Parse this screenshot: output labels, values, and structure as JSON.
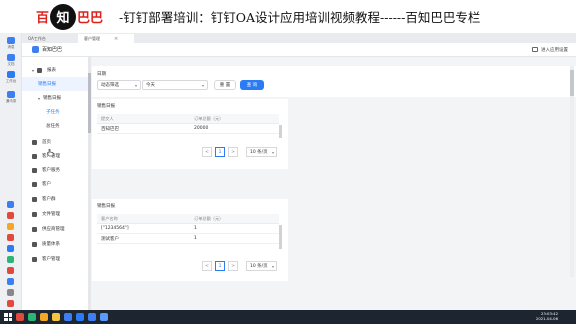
{
  "banner": {
    "brand_part1": "百",
    "brand_circle": "知",
    "brand_part2": "巴巴",
    "title": "-钉钉部署培训：钉钉OA设计应用培训视频教程------百知巴巴专栏"
  },
  "dock": [
    {
      "icon": "message-icon",
      "label": "消息",
      "color": "#3d7ef0"
    },
    {
      "icon": "document-icon",
      "label": "文档",
      "color": "#3d7ef0"
    },
    {
      "icon": "workbench-icon",
      "label": "工作台",
      "color": "#2a7bf4"
    },
    {
      "icon": "contacts-icon",
      "label": "通讯录",
      "color": "#3d7ef0"
    }
  ],
  "dock_bottom_colors": [
    "#3d7ef0",
    "#e0493b",
    "#f5a623",
    "#e0493b",
    "#2a7bf4",
    "#2bb673",
    "#e0493b",
    "#3d7ef0",
    "#888888",
    "#e0493b"
  ],
  "tabs": [
    {
      "label": "OA工作台"
    },
    {
      "label": "客户管理",
      "close": "×"
    }
  ],
  "appbar": {
    "app_name": "百知巴巴",
    "enter_settings": "进入应用设置"
  },
  "sidebar": [
    {
      "label": "报表",
      "level": 0,
      "caret": "▾"
    },
    {
      "label": "销售日报",
      "level": 1,
      "selected": true
    },
    {
      "label": "销售日报",
      "level": 1,
      "caret": "▾"
    },
    {
      "label": "子任务",
      "level": 2,
      "highlight": true
    },
    {
      "label": "总任务",
      "level": 2
    },
    {
      "label": "首页",
      "level": 0
    },
    {
      "label": "客户管理",
      "level": 0
    },
    {
      "label": "客户服务",
      "level": 0
    },
    {
      "label": "客户",
      "level": 0
    },
    {
      "label": "客户群",
      "level": 0
    },
    {
      "label": "文件管理",
      "level": 0
    },
    {
      "label": "供应商管理",
      "level": 0
    },
    {
      "label": "质量体系",
      "level": 0
    },
    {
      "label": "客户管理",
      "level": 0
    }
  ],
  "filter": {
    "label": "日期",
    "select1": "动态筛选",
    "select2": "今天",
    "reset": "重 置",
    "query": "查 询"
  },
  "card1": {
    "title": "销售日报",
    "columns": [
      "提交人",
      "订单总额（元）"
    ],
    "rows": [
      [
        "百知巴巴",
        "20000"
      ]
    ],
    "page": "1",
    "page_size": "10 条/页",
    "prev": "<",
    "next": ">"
  },
  "card2": {
    "title": "销售日报",
    "columns": [
      "客户名称",
      "订单总额（元）"
    ],
    "rows": [
      [
        "[\"1234564\"]",
        "1"
      ],
      [
        "测试客户",
        "1"
      ]
    ],
    "page": "1",
    "page_size": "10 条/页",
    "prev": "<",
    "next": ">"
  },
  "taskbar": {
    "time": "23:03:42",
    "date": "2021-04-06",
    "icons": [
      {
        "icon": "browser-icon",
        "color": "#e0493b"
      },
      {
        "icon": "chrome-icon",
        "color": "#2bb673"
      },
      {
        "icon": "chrome-icon",
        "color": "#f5a623"
      },
      {
        "icon": "folder-icon",
        "color": "#f5c542"
      },
      {
        "icon": "app-icon",
        "color": "#3d7ef0"
      },
      {
        "icon": "app-icon",
        "color": "#2a7bf4"
      },
      {
        "icon": "app-icon",
        "color": "#3d7ef0"
      },
      {
        "icon": "app-icon",
        "color": "#5a9af8"
      }
    ]
  }
}
